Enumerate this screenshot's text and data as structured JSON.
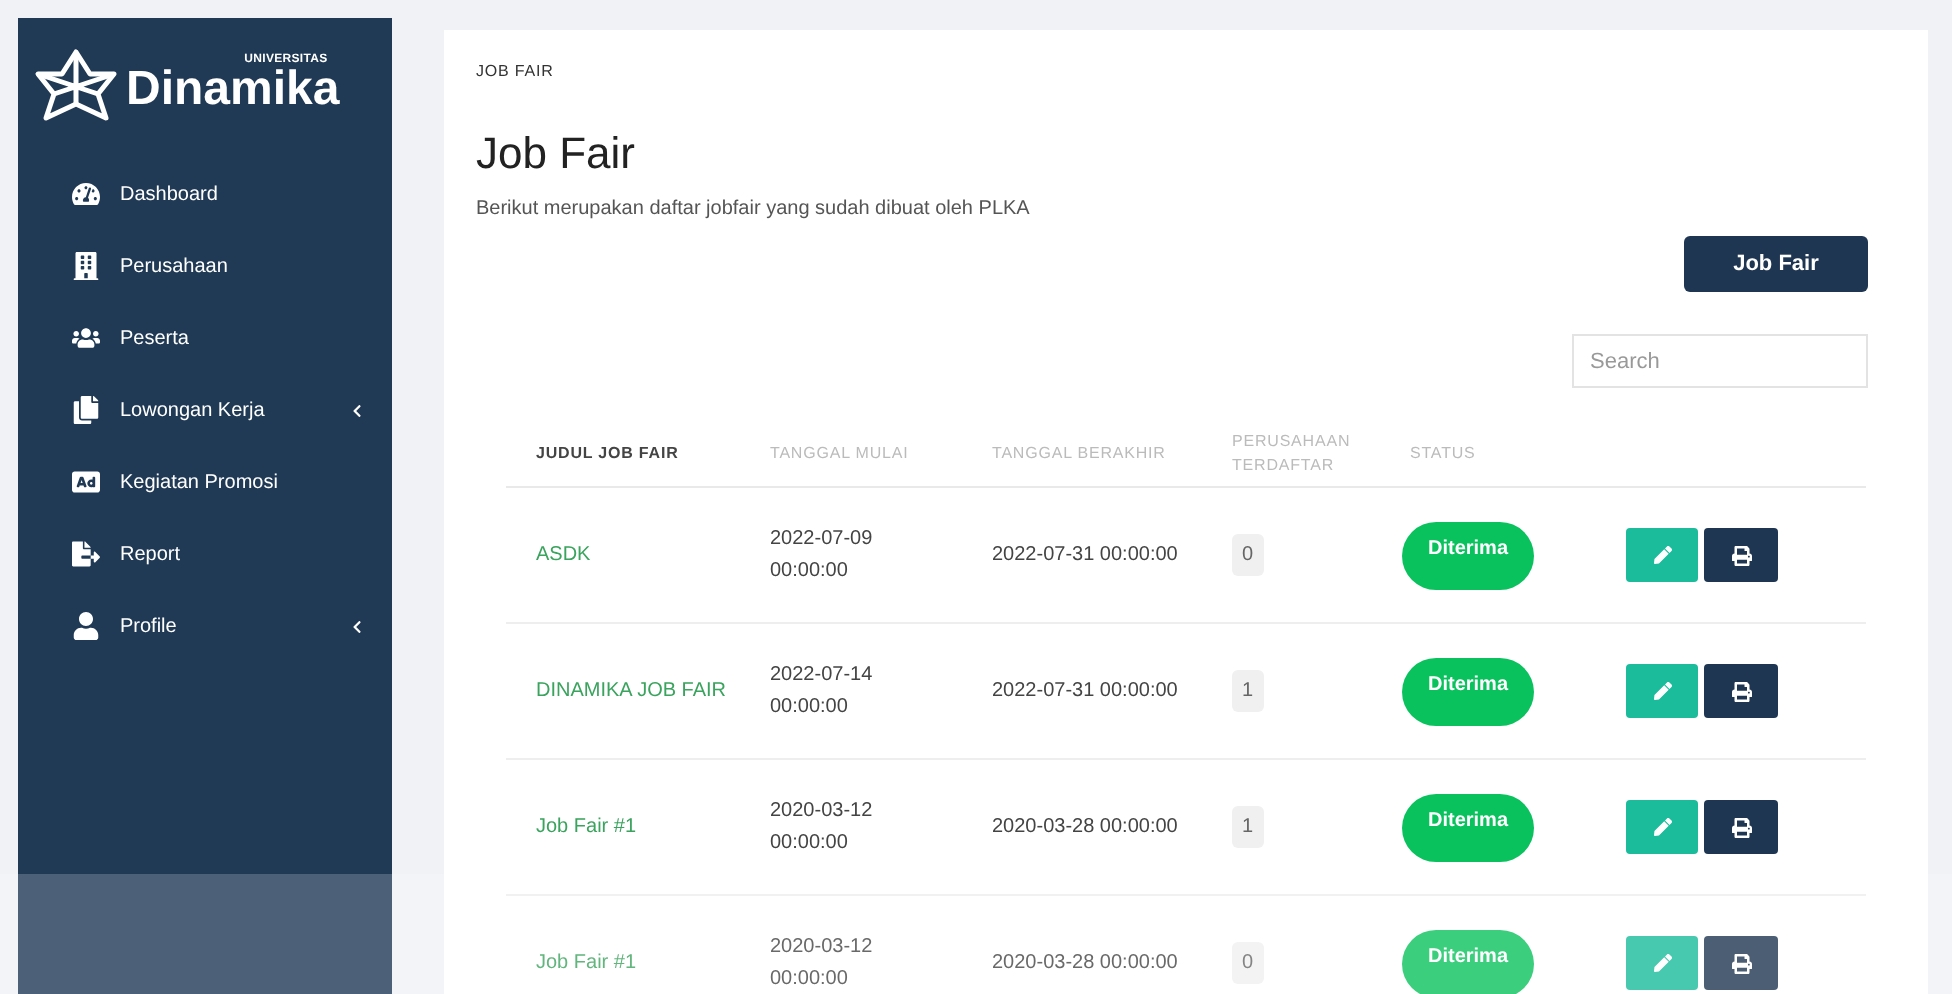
{
  "brand": {
    "small": "UNIVERSITAS",
    "name": "Dinamika"
  },
  "sidebar": {
    "items": [
      {
        "label": "Dashboard",
        "has_submenu": false
      },
      {
        "label": "Perusahaan",
        "has_submenu": false
      },
      {
        "label": "Peserta",
        "has_submenu": false
      },
      {
        "label": "Lowongan Kerja",
        "has_submenu": true
      },
      {
        "label": "Kegiatan Promosi",
        "has_submenu": false
      },
      {
        "label": "Report",
        "has_submenu": false
      },
      {
        "label": "Profile",
        "has_submenu": true
      }
    ]
  },
  "breadcrumb": "JOB FAIR",
  "title": "Job Fair",
  "subtitle": "Berikut merupakan daftar jobfair yang sudah dibuat oleh PLKA",
  "add_button": "Job Fair",
  "search": {
    "placeholder": "Search"
  },
  "table": {
    "columns": [
      "JUDUL JOB FAIR",
      "TANGGAL MULAI",
      "TANGGAL BERAKHIR",
      "PERUSAHAAN TERDAFTAR",
      "STATUS"
    ],
    "rows": [
      {
        "title": "ASDK",
        "start": [
          "2022-07-09",
          "00:00:00"
        ],
        "end": "2022-07-31 00:00:00",
        "companies": "0",
        "status": "Diterima"
      },
      {
        "title": "DINAMIKA JOB FAIR",
        "start": [
          "2022-07-14",
          "00:00:00"
        ],
        "end": "2022-07-31 00:00:00",
        "companies": "1",
        "status": "Diterima"
      },
      {
        "title": "Job Fair #1",
        "start": [
          "2020-03-12",
          "00:00:00"
        ],
        "end": "2020-03-28 00:00:00",
        "companies": "1",
        "status": "Diterima"
      },
      {
        "title": "Job Fair #1",
        "start": [
          "2020-03-12",
          "00:00:00"
        ],
        "end": "2020-03-28 00:00:00",
        "companies": "0",
        "status": "Diterima"
      }
    ]
  }
}
